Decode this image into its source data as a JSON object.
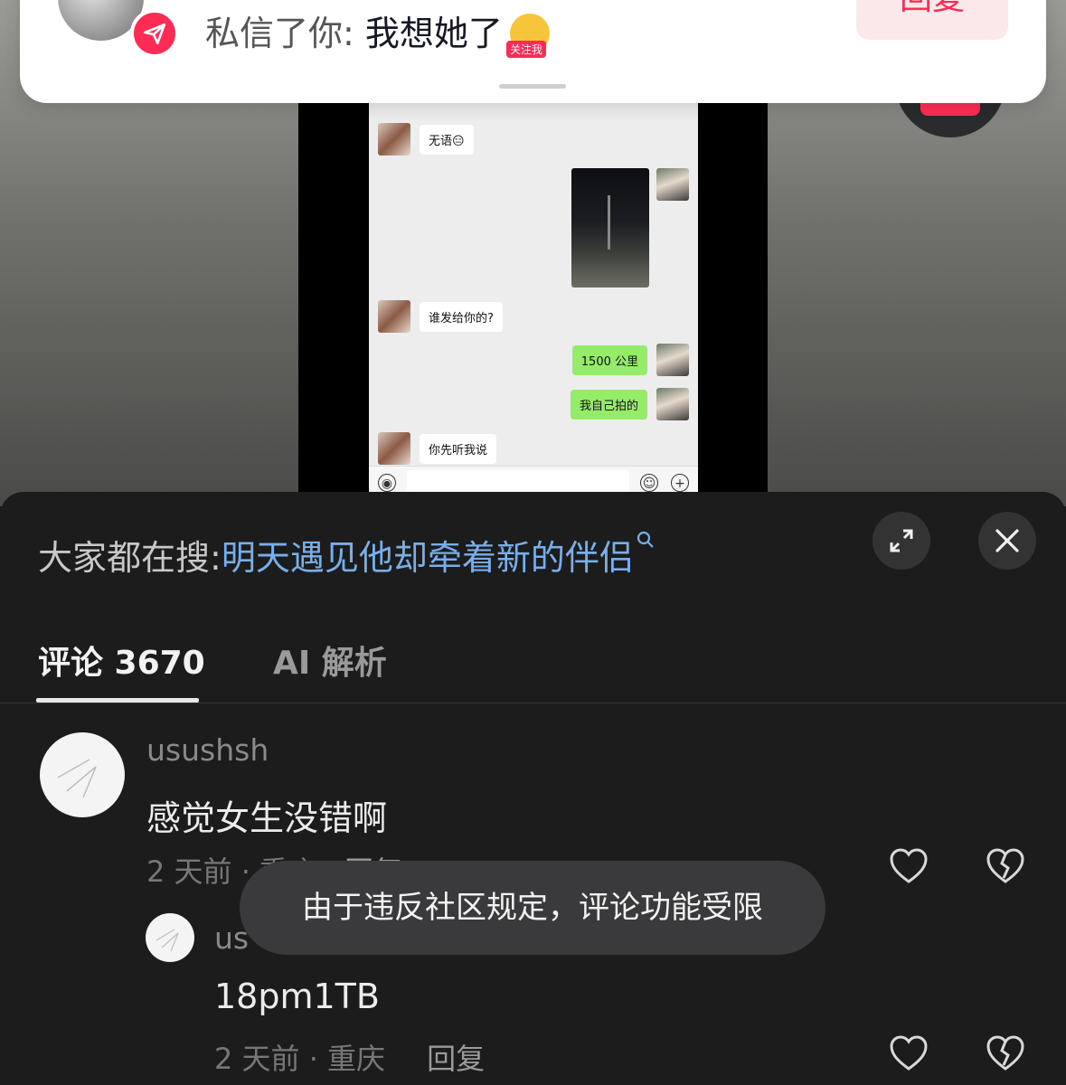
{
  "notification": {
    "text_prefix": "私信了你: ",
    "message": "我想她了",
    "emoji_tag": "关注我",
    "reply_label": "回复"
  },
  "chat": {
    "messages": [
      {
        "side": "left",
        "text": "无语😑"
      },
      {
        "side": "right",
        "type": "image"
      },
      {
        "side": "left",
        "text": "谁发给你的?"
      },
      {
        "side": "right",
        "text": "1500 公里"
      },
      {
        "side": "right",
        "text": "我自己拍的"
      },
      {
        "side": "left",
        "text": "你先听我说"
      }
    ]
  },
  "panel": {
    "search_prefix": "大家都在搜:",
    "search_query": "明天遇见他却牵着新的伴侣",
    "tabs": [
      {
        "label": "评论 3670",
        "active": true
      },
      {
        "label": "AI 解析",
        "active": false
      }
    ]
  },
  "comments": [
    {
      "username": "usushsh",
      "text": "感觉女生没错啊",
      "meta": "2 天前 · 重庆",
      "reply_label": "回复"
    },
    {
      "username": "us",
      "text": "18pm1TB",
      "meta": "2 天前 · 重庆",
      "reply_label": "回复"
    }
  ],
  "toast": "由于违反社区规定，评论功能受限",
  "colors": {
    "brand_red": "#fe2c55",
    "link_blue": "#78aeea",
    "panel_bg": "#1c1c1c",
    "chat_green": "#95ec69"
  }
}
